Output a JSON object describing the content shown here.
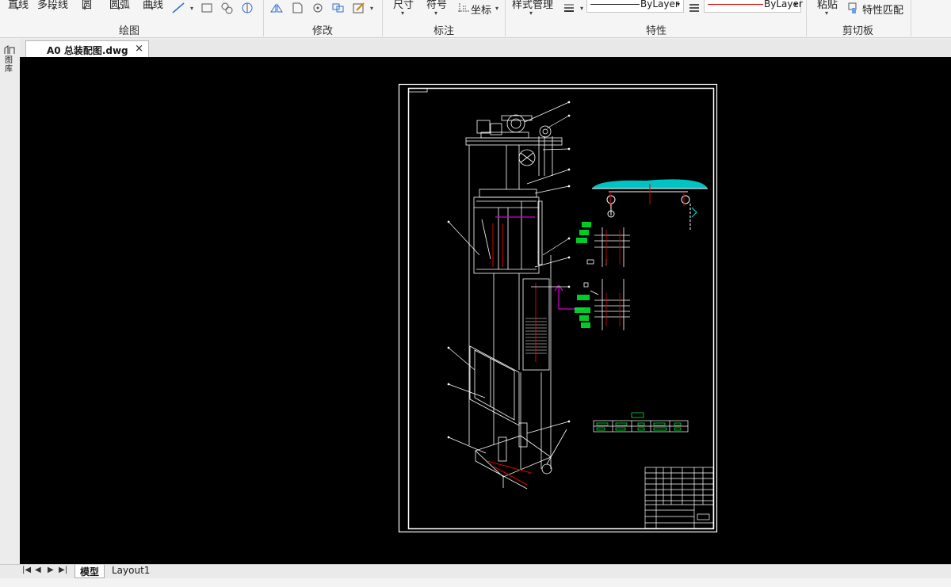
{
  "ribbon": {
    "draw": {
      "line": "直线",
      "polyline": "多段线",
      "circle": "圆",
      "arc": "圆弧",
      "curve": "曲线",
      "group": "绘图"
    },
    "modify": {
      "group": "修改"
    },
    "annotate": {
      "dimension": "尺寸",
      "symbol": "符号",
      "coordinate": "坐标",
      "group": "标注"
    },
    "properties": {
      "style_manager": "样式管理",
      "layer1": "ByLayer",
      "layer2": "ByLayer",
      "group": "特性"
    },
    "clipboard": {
      "paste": "粘贴",
      "match_props": "特性匹配",
      "group": "剪切板"
    }
  },
  "document_tab": {
    "title": "A0 总装配图.dwg",
    "close": "×"
  },
  "side_panel": {
    "label": "图库"
  },
  "layout_tabs": [
    {
      "label": "模型"
    },
    {
      "label": "Layout1"
    }
  ],
  "colors": {
    "canvas": "#000000",
    "drawing": "#ffffff",
    "accent_cyan": "#00e5e5",
    "accent_green": "#00ff33",
    "accent_magenta": "#d000d0",
    "red_line": "#e00000"
  }
}
